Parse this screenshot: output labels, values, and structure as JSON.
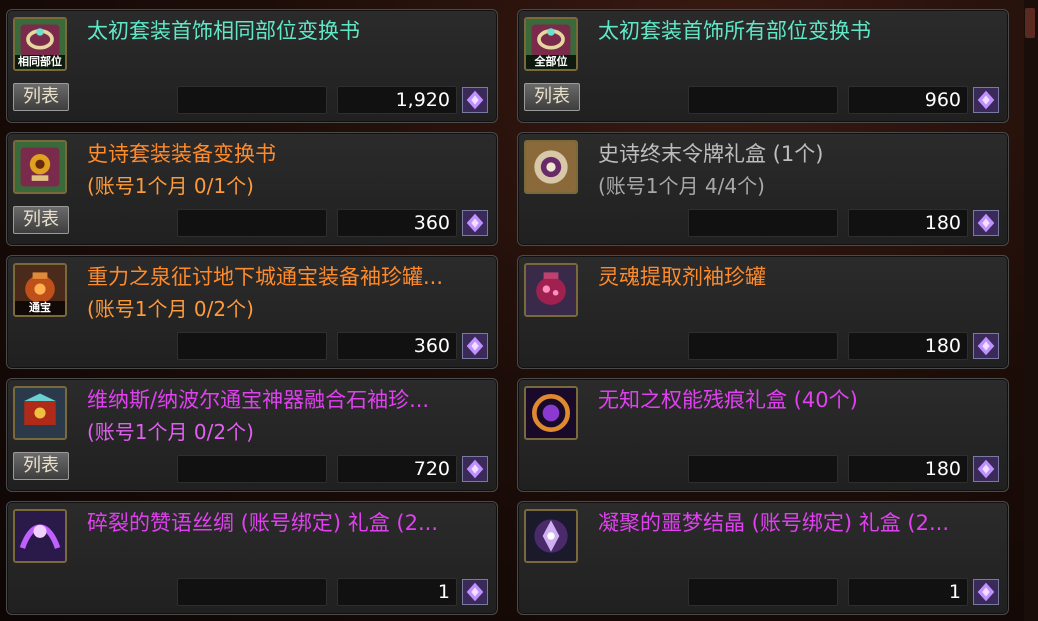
{
  "colors": {
    "cyan_name": "#5fe8c8",
    "orange_name": "#ff8a2a",
    "purple_name": "#e040f0",
    "gray_name": "#bdbdbd",
    "orange_sub": "#ff9a3a",
    "purple_sub": "#e060f0",
    "gray_sub": "#a8a8a8"
  },
  "items": [
    {
      "name": "太初套装首饰相同部位变换书",
      "sub": "",
      "price": "1,920",
      "icon_label": "相同部位",
      "list_label": "列表",
      "icon": "ring-scroll-icon"
    },
    {
      "name": "太初套装首饰所有部位变换书",
      "sub": "",
      "price": "960",
      "icon_label": "全部位",
      "list_label": "列表",
      "icon": "ring-scroll-icon"
    },
    {
      "name": "史诗套装装备变换书",
      "sub": "(账号1个月 0/1个)",
      "price": "360",
      "icon_label": "",
      "list_label": "列表",
      "icon": "epic-scroll-icon"
    },
    {
      "name": "史诗终末令牌礼盒 (1个)",
      "sub": "(账号1个月 4/4个)",
      "price": "180",
      "icon_label": "",
      "list_label": "",
      "icon": "token-box-icon"
    },
    {
      "name": "重力之泉征讨地下城通宝装备袖珍罐...",
      "sub": "(账号1个月 0/2个)",
      "price": "360",
      "icon_label": "通宝",
      "list_label": "",
      "icon": "jar-icon"
    },
    {
      "name": "灵魂提取剂袖珍罐",
      "sub": "",
      "price": "180",
      "icon_label": "",
      "list_label": "",
      "icon": "soul-jar-icon"
    },
    {
      "name": "维纳斯/纳波尔通宝神器融合石袖珍...",
      "sub": "(账号1个月 0/2个)",
      "price": "720",
      "icon_label": "",
      "list_label": "列表",
      "icon": "fusion-stone-icon"
    },
    {
      "name": "无知之权能残痕礼盒 (40个)",
      "sub": "",
      "price": "180",
      "icon_label": "",
      "list_label": "",
      "icon": "swirl-icon"
    },
    {
      "name": "碎裂的赞语丝绸 (账号绑定) 礼盒 (2...",
      "sub": "",
      "price": "1",
      "icon_label": "",
      "list_label": "",
      "icon": "silk-icon"
    },
    {
      "name": "凝聚的噩梦结晶 (账号绑定) 礼盒 (2...",
      "sub": "",
      "price": "1",
      "icon_label": "",
      "list_label": "",
      "icon": "crystal-icon"
    }
  ]
}
